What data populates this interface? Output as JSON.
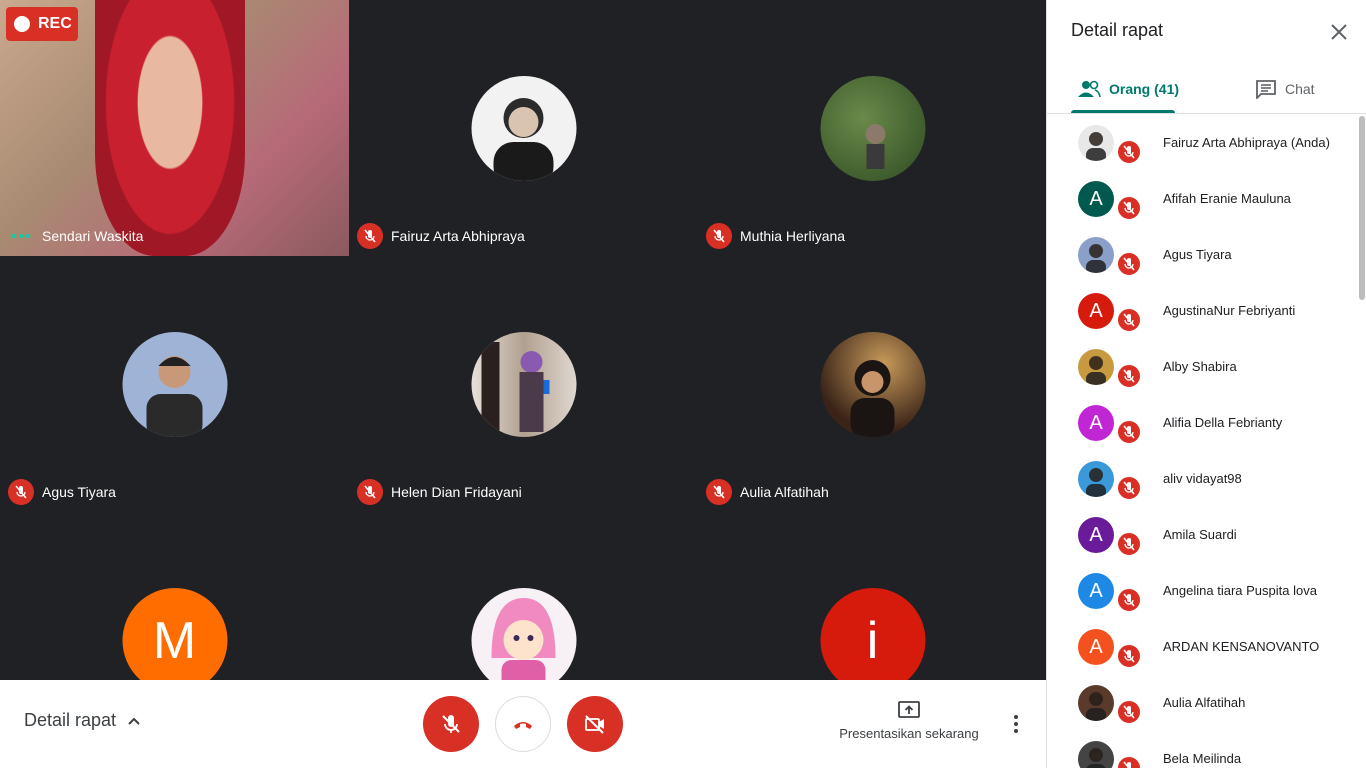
{
  "recording": {
    "label": "REC"
  },
  "tiles": [
    {
      "name": "Sendari Waskita",
      "kind": "video",
      "status": "speaking"
    },
    {
      "name": "Fairuz Arta Abhipraya",
      "kind": "avatar-photo",
      "status": "muted"
    },
    {
      "name": "Muthia Herliyana",
      "kind": "avatar-photo",
      "status": "muted"
    },
    {
      "name": "Agus Tiyara",
      "kind": "avatar-photo",
      "status": "muted"
    },
    {
      "name": "Helen Dian Fridayani",
      "kind": "avatar-photo",
      "status": "muted"
    },
    {
      "name": "Aulia Alfatihah",
      "kind": "avatar-photo",
      "status": "muted"
    },
    {
      "name": "",
      "kind": "avatar-letter",
      "letter": "M",
      "color": "#ff6d00"
    },
    {
      "name": "",
      "kind": "avatar-photo"
    },
    {
      "name": "",
      "kind": "avatar-letter",
      "letter": "i",
      "color": "#d61a0b"
    }
  ],
  "bottom_bar": {
    "details_label": "Detail rapat",
    "present_label": "Presentasikan sekarang"
  },
  "panel": {
    "title": "Detail rapat",
    "tabs": [
      {
        "label": "Orang (41)",
        "icon": "people-icon",
        "active": true
      },
      {
        "label": "Chat",
        "icon": "chat-icon",
        "active": false
      }
    ],
    "participants": [
      {
        "name": "Fairuz Arta Abhipraya (Anda)",
        "avatar": "photo",
        "color": "#e8e8e8"
      },
      {
        "name": "Afifah Eranie Mauluna",
        "letter": "A",
        "color": "#00594f"
      },
      {
        "name": "Agus Tiyara",
        "avatar": "photo",
        "color": "#8aa0c8"
      },
      {
        "name": "AgustinaNur Febriyanti",
        "letter": "A",
        "color": "#d61a0b"
      },
      {
        "name": "Alby Shabira",
        "avatar": "photo",
        "color": "#c89a40"
      },
      {
        "name": "Alifia Della Febrianty",
        "letter": "A",
        "color": "#c026d3"
      },
      {
        "name": "aliv vidayat98",
        "avatar": "photo",
        "color": "#3a9ad9"
      },
      {
        "name": "Amila Suardi",
        "letter": "A",
        "color": "#6a1b9a"
      },
      {
        "name": "Angelina tiara Puspita lova",
        "letter": "A",
        "color": "#1e88e5"
      },
      {
        "name": "ARDAN KENSANOVANTO",
        "letter": "A",
        "color": "#f4511e"
      },
      {
        "name": "Aulia Alfatihah",
        "avatar": "photo",
        "color": "#5a3a2a"
      },
      {
        "name": "Bela Meilinda",
        "avatar": "photo",
        "color": "#444444"
      }
    ]
  },
  "colors": {
    "accent": "#00796b",
    "danger": "#d93025",
    "stage": "#202124"
  }
}
